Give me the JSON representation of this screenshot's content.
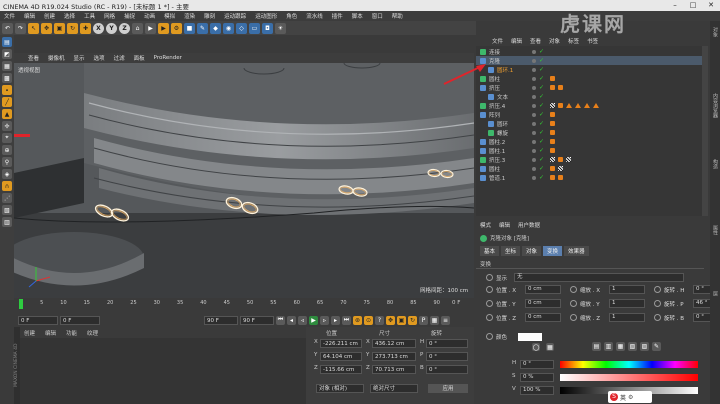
{
  "window": {
    "title": "CINEMA 4D R19.024 Studio (RC - R19) - [未标题 1 *] - 主要"
  },
  "watermark": "虎课网",
  "menus": [
    "文件",
    "编辑",
    "创建",
    "选择",
    "工具",
    "网格",
    "捕捉",
    "动画",
    "模拟",
    "渲染",
    "雕刻",
    "运动跟踪",
    "运动图形",
    "角色",
    "流水线",
    "插件",
    "脚本",
    "窗口",
    "帮助"
  ],
  "toolbar": {
    "axis": [
      "X",
      "Y",
      "Z"
    ]
  },
  "viewport": {
    "menu": [
      "查看",
      "摄像机",
      "显示",
      "选项",
      "过滤",
      "面板",
      "ProRender"
    ],
    "label": "透视视图",
    "grid_label": "网格间距：100 cm"
  },
  "timeline": {
    "ticks": [
      "0",
      "5",
      "10",
      "15",
      "20",
      "25",
      "30",
      "35",
      "40",
      "45",
      "50",
      "55",
      "60",
      "65",
      "70",
      "75",
      "80",
      "85",
      "90"
    ],
    "right_label": "0 F"
  },
  "transport": {
    "start": "0 F",
    "current": "0 F",
    "end": "90 F",
    "end2": "90 F"
  },
  "materials": {
    "menu": [
      "创建",
      "编辑",
      "功能",
      "纹理"
    ]
  },
  "coords": {
    "headers": [
      "位置",
      "尺寸",
      "旋转"
    ],
    "rows": [
      {
        "axis": "X",
        "pos": "-226.211 cm",
        "size_axis": "X",
        "size": "436.12 cm",
        "rot_axis": "H",
        "rot": "0 °"
      },
      {
        "axis": "Y",
        "pos": "64.104 cm",
        "size_axis": "Y",
        "size": "273.713 cm",
        "rot_axis": "P",
        "rot": "0 °"
      },
      {
        "axis": "Z",
        "pos": "-115.66 cm",
        "size_axis": "Z",
        "size": "70.713 cm",
        "rot_axis": "B",
        "rot": "0 °"
      }
    ],
    "mode1": "对象 (相对)",
    "mode2": "绝对尺寸",
    "apply": "应用"
  },
  "objects": {
    "tabs": [
      "文件",
      "编辑",
      "查看",
      "对象",
      "标签",
      "书签"
    ],
    "items": [
      {
        "name": "连接",
        "indent": 0
      },
      {
        "name": "克隆",
        "indent": 0
      },
      {
        "name": "圆环.1",
        "indent": 1
      },
      {
        "name": "圆柱",
        "indent": 0
      },
      {
        "name": "挤压",
        "indent": 0
      },
      {
        "name": "文本",
        "indent": 1
      },
      {
        "name": "挤压.4",
        "indent": 0
      },
      {
        "name": "阵列",
        "indent": 0
      },
      {
        "name": "圆环",
        "indent": 1
      },
      {
        "name": "螺旋",
        "indent": 1
      },
      {
        "name": "圆柱.2",
        "indent": 0
      },
      {
        "name": "圆柱.1",
        "indent": 0
      },
      {
        "name": "挤压.3",
        "indent": 0
      },
      {
        "name": "圆柱",
        "indent": 0
      },
      {
        "name": "管道.1",
        "indent": 0
      }
    ]
  },
  "attributes": {
    "tabs": [
      "模式",
      "编辑",
      "用户数据"
    ],
    "object_title": "克隆对象 [克隆]",
    "subtabs": [
      "基本",
      "坐标",
      "对象",
      "变换",
      "效果器"
    ],
    "active_subtab": "变换",
    "section": "变换",
    "display_label": "显示",
    "display_value": "无",
    "rows": [
      {
        "p_label": "位置 . X",
        "p_val": "0 cm",
        "s_label": "缩放 . X",
        "s_val": "1",
        "r_label": "旋转 . H",
        "r_val": "0 °"
      },
      {
        "p_label": "位置 . Y",
        "p_val": "0 cm",
        "s_label": "缩放 . Y",
        "s_val": "1",
        "r_label": "旋转 . P",
        "r_val": "46 °"
      },
      {
        "p_label": "位置 . Z",
        "p_val": "0 cm",
        "s_label": "缩放 . Z",
        "s_val": "1",
        "r_label": "旋转 . B",
        "r_val": "0 °"
      }
    ],
    "color_label": "颜色",
    "hsv": [
      {
        "k": "H",
        "v": "0 °"
      },
      {
        "k": "S",
        "v": "0 %"
      },
      {
        "k": "V",
        "v": "100 %"
      }
    ]
  },
  "right_strip": [
    "对象",
    "内容浏览器",
    "构造",
    "属性",
    "层"
  ],
  "ime": "英",
  "side_vertical_label": "MAXON CINEMA 4D"
}
